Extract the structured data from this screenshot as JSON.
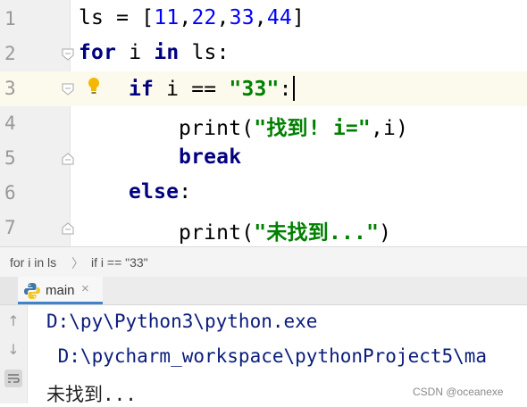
{
  "editor": {
    "line_numbers": [
      "1",
      "2",
      "3",
      "4",
      "5",
      "6",
      "7"
    ],
    "line1": {
      "ident": "ls",
      "op": " = [",
      "n1": "11",
      "c1": ",",
      "n2": "22",
      "c2": ",",
      "n3": "33",
      "c3": ",",
      "n4": "44",
      "close": "]"
    },
    "line2": {
      "kw_for": "for",
      "var": " i ",
      "kw_in": "in",
      "rest": " ls:"
    },
    "line3": {
      "kw_if": "if",
      "cond": " i == ",
      "str": "\"33\"",
      "colon": ":"
    },
    "line4": {
      "func": "print(",
      "str": "\"找到! i=\"",
      "rest": ",i)"
    },
    "line5": {
      "kw_break": "break"
    },
    "line6": {
      "kw_else": "else",
      "colon": ":"
    },
    "line7": {
      "func": "print(",
      "str": "\"未找到...\"",
      "rest": ")"
    }
  },
  "breadcrumb": {
    "item1": "for i in ls",
    "separator": "〉",
    "item2": "if i == \"33\""
  },
  "run_panel": {
    "tab_label": "main",
    "tab_close": "×",
    "output_line1": "D:\\py\\Python3\\python.exe",
    "output_line2": " D:\\pycharm_workspace\\pythonProject5\\ma",
    "output_line3": "未找到..."
  },
  "watermark": "CSDN @oceanexe",
  "colors": {
    "keyword": "#000080",
    "number": "#0000ff",
    "string": "#008000",
    "current_line": "#fcfaed",
    "console_path": "#0b1c7c"
  },
  "icons": [
    "fold-icon",
    "lightbulb-icon",
    "python-icon",
    "up-arrow-icon",
    "down-arrow-icon",
    "wrap-icon"
  ]
}
